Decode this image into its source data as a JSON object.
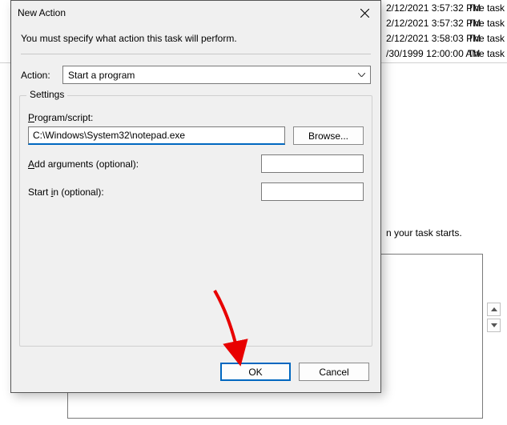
{
  "background": {
    "rows": [
      {
        "date": "2/12/2021 3:57:32 PM",
        "desc": "The task i"
      },
      {
        "date": "2/12/2021 3:57:32 PM",
        "desc": "The task i"
      },
      {
        "date": "2/12/2021 3:58:03 PM",
        "desc": "The task i"
      },
      {
        "date": "/30/1999 12:00:00 AM",
        "desc": "The task h"
      }
    ],
    "hint": "n your task starts."
  },
  "dialog": {
    "title": "New Action",
    "instruction": "You must specify what action this task will perform.",
    "action_label": "Action:",
    "action_selected": "Start a program",
    "group_title": "Settings",
    "program_label_pre": "P",
    "program_label_rest": "rogram/script:",
    "program_value": "C:\\Windows\\System32\\notepad.exe",
    "browse_label": "Browse...",
    "args_label_pre": "A",
    "args_label_rest": "dd arguments (optional):",
    "args_value": "",
    "startin_label_pre": "Start ",
    "startin_label_u": "i",
    "startin_label_rest": "n (optional):",
    "startin_value": "",
    "ok_label": "OK",
    "cancel_label": "Cancel"
  }
}
